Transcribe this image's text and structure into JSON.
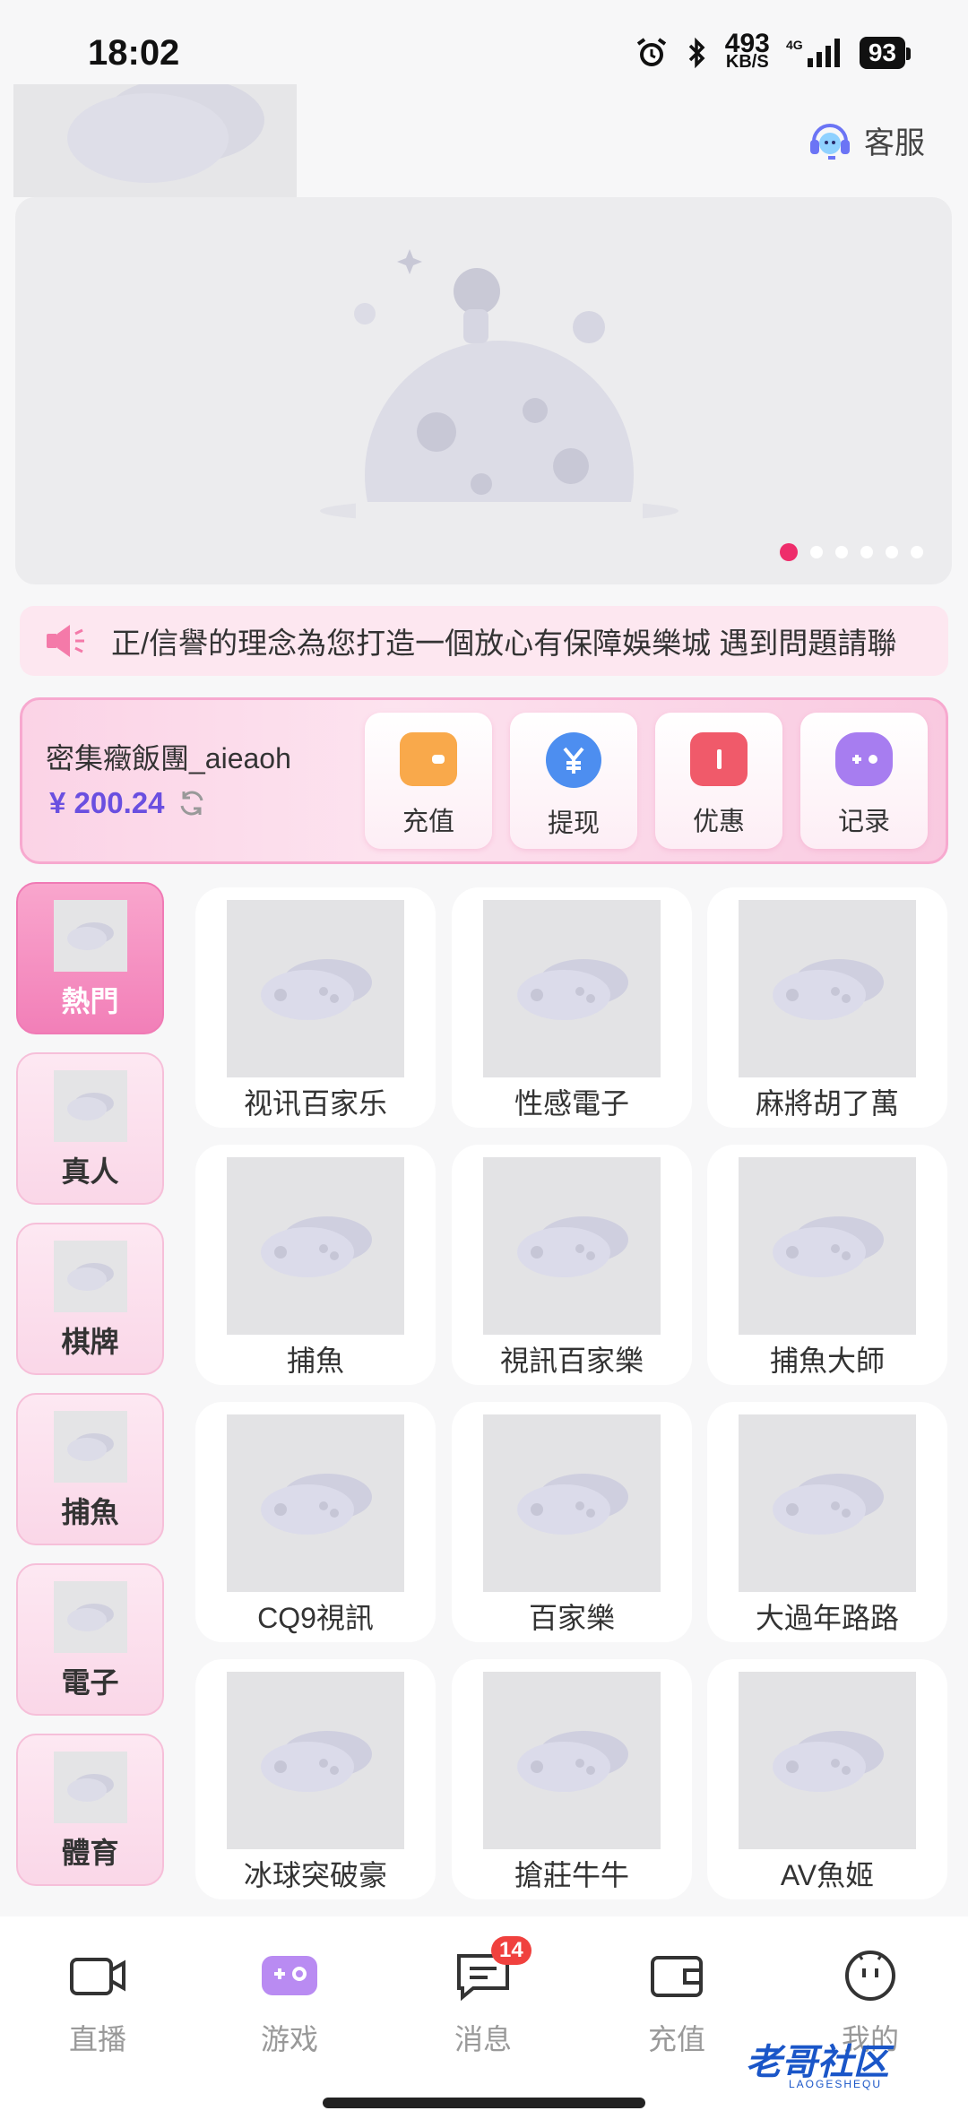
{
  "status_bar": {
    "time": "18:02",
    "speed_value": "493",
    "speed_unit": "KB/S",
    "network": "4G",
    "battery": "93",
    "icons": [
      "alarm-icon",
      "bluetooth-icon",
      "signal-icon"
    ]
  },
  "header": {
    "service_label": "客服"
  },
  "banner": {
    "dot_count": 6,
    "active_dot": 0
  },
  "marquee": {
    "text": "正/信譽的理念為您打造一個放心有保障娛樂城  遇到問題請聯"
  },
  "account": {
    "username": "密集癥飯團_aieaoh",
    "balance": "¥ 200.24",
    "actions": [
      {
        "label": "充值",
        "icon": "wallet-icon",
        "color": "#f9a94b"
      },
      {
        "label": "提现",
        "icon": "yen-icon",
        "color": "#4d8ef0"
      },
      {
        "label": "优惠",
        "icon": "ticket-icon",
        "color": "#f05a6a"
      },
      {
        "label": "记录",
        "icon": "gamepad-icon",
        "color": "#a77df0"
      }
    ]
  },
  "categories": [
    {
      "label": "熱門",
      "active": true
    },
    {
      "label": "真人",
      "active": false
    },
    {
      "label": "棋牌",
      "active": false
    },
    {
      "label": "捕魚",
      "active": false
    },
    {
      "label": "電子",
      "active": false
    },
    {
      "label": "體育",
      "active": false
    }
  ],
  "games": [
    "视讯百家乐",
    "性感電子",
    "麻將胡了萬",
    "捕魚",
    "視訊百家樂",
    "捕魚大師",
    "CQ9視訊",
    "百家樂",
    "大過年路路",
    "冰球突破豪",
    "搶莊牛牛",
    "AV魚姬"
  ],
  "bottom_nav": [
    {
      "label": "直播",
      "icon": "camera-icon"
    },
    {
      "label": "游戏",
      "icon": "gamepad-icon"
    },
    {
      "label": "消息",
      "icon": "message-icon",
      "badge": "14"
    },
    {
      "label": "充值",
      "icon": "wallet-icon"
    },
    {
      "label": "我的",
      "icon": "profile-icon"
    }
  ],
  "watermark": {
    "text": "老哥社区",
    "sub": "LAOGESHEQU"
  },
  "colors": {
    "accent_pink": "#ee2d6b",
    "balance_purple": "#6a4fe0",
    "badge_red": "#f0413e",
    "nav_active_purple": "#b98bf2"
  }
}
